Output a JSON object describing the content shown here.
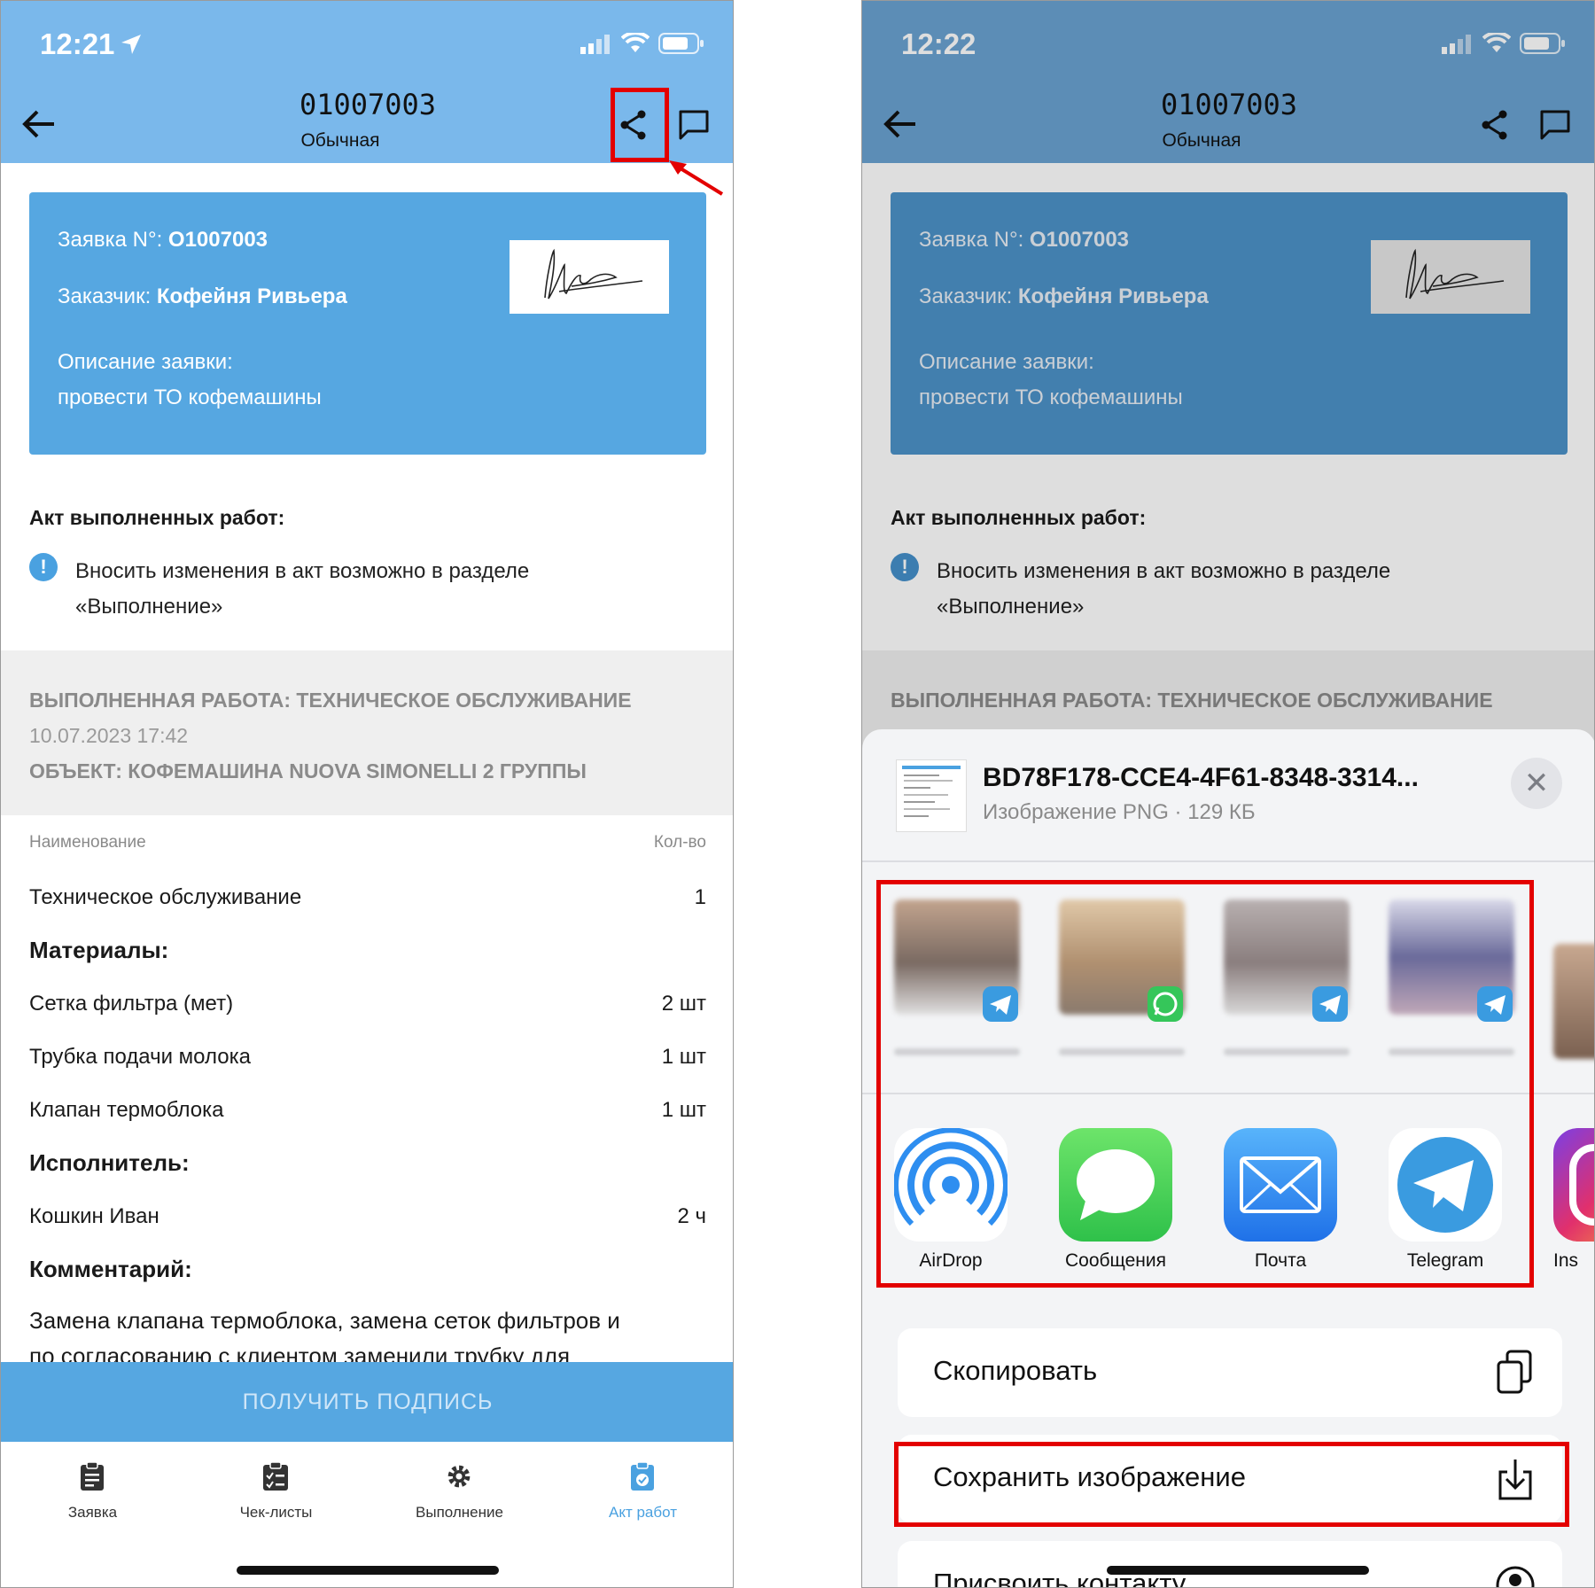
{
  "left": {
    "status_time": "12:21",
    "header_title": "01007003",
    "header_sub": "Обычная",
    "card": {
      "order_label": "Заявка N°: ",
      "order_value": "O1007003",
      "customer_label": "Заказчик: ",
      "customer_value": "Кофейня Ривьера",
      "desc_label": "Описание заявки:",
      "desc_value": "провести ТО кофемашины"
    },
    "act_title": "Акт выполненных работ:",
    "note_line1": "Вносить изменения в акт возможно в разделе",
    "note_line2": "«Выполнение»",
    "band": {
      "work": "ВЫПОЛНЕННАЯ РАБОТА:  ТЕХНИЧЕСКОЕ ОБСЛУЖИВАНИЕ",
      "date": "10.07.2023 17:42",
      "object": "ОБЪЕКТ:  КОФЕМАШИНА NUOVA SIMONELLI 2 ГРУППЫ"
    },
    "col_name": "Наименование",
    "col_qty": "Кол-во",
    "rows": [
      {
        "name": "Техническое обслуживание",
        "qty": "1"
      },
      {
        "name": "Сетка фильтра (мет)",
        "qty": "2 шт"
      },
      {
        "name": "Трубка подачи молока",
        "qty": "1 шт"
      },
      {
        "name": "Клапан термоблока",
        "qty": "1 шт"
      },
      {
        "name": "Кошкин Иван",
        "qty": "2 ч"
      }
    ],
    "materials": "Материалы:",
    "executor": "Исполнитель:",
    "comment": "Комментарий:",
    "comment_line1": "Замена клапана термоблока, замена сеток фильтров и",
    "comment_line2": "по согласованию с клиентом заменили трубку для",
    "sign_button": "ПОЛУЧИТЬ ПОДПИСЬ",
    "tabs": [
      {
        "label": "Заявка",
        "icon": "clipboard-icon"
      },
      {
        "label": "Чек-листы",
        "icon": "checklist-icon"
      },
      {
        "label": "Выполнение",
        "icon": "gear-icon"
      },
      {
        "label": "Акт работ",
        "icon": "act-icon",
        "active": true
      }
    ],
    "accent": "#56a7e1"
  },
  "right": {
    "status_time": "12:22",
    "file_name": "BD78F178-CCE4-4F61-8348-3314...",
    "file_info": "Изображение PNG · 129 КБ",
    "apps": [
      {
        "label": "AirDrop",
        "icon": "airdrop-icon"
      },
      {
        "label": "Сообщения",
        "icon": "messages-icon"
      },
      {
        "label": "Почта",
        "icon": "mail-icon"
      },
      {
        "label": "Telegram",
        "icon": "telegram-icon"
      },
      {
        "label": "Ins",
        "icon": "instagram-icon"
      }
    ],
    "actions": [
      {
        "label": "Скопировать",
        "icon": "copy-icon"
      },
      {
        "label": "Сохранить изображение",
        "icon": "save-icon"
      },
      {
        "label": "Присвоить контакту",
        "icon": "contact-icon"
      }
    ]
  }
}
